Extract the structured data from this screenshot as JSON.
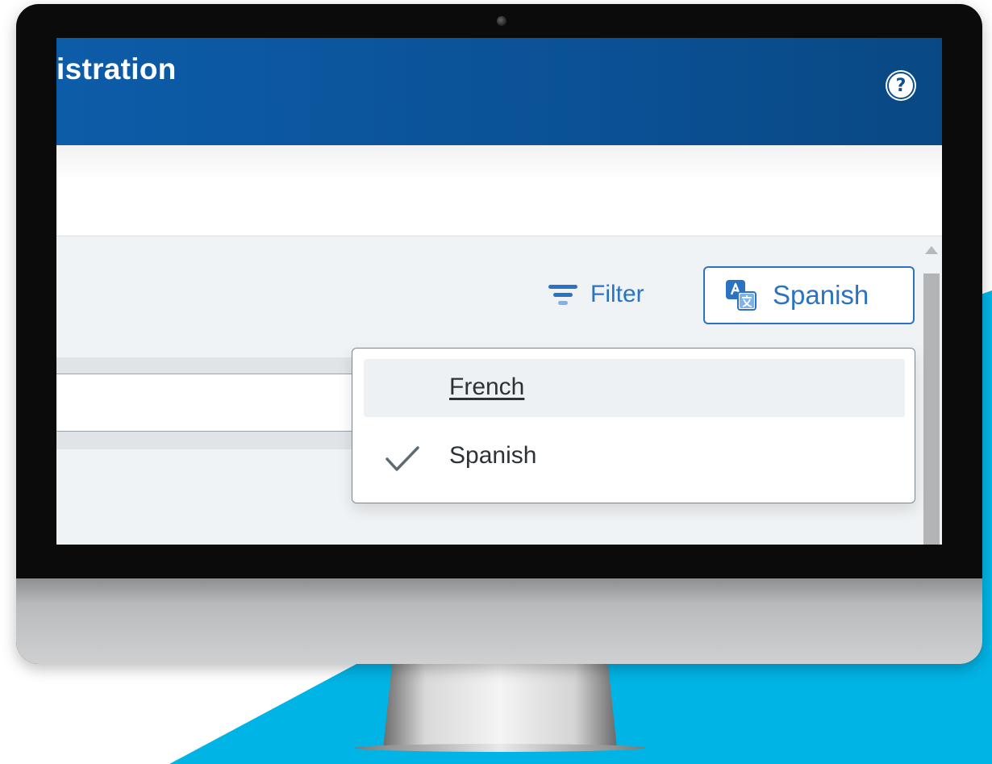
{
  "header": {
    "title": "istration",
    "help_glyph": "?"
  },
  "toolbar": {
    "filter_label": "Filter",
    "language_button_label": "Spanish",
    "filter_icon": "filter-icon",
    "language_icon": "translate-icon"
  },
  "language_menu": {
    "options": [
      {
        "label": "French",
        "selected": false,
        "hovered": true
      },
      {
        "label": "Spanish",
        "selected": true,
        "hovered": false
      }
    ]
  },
  "colors": {
    "header_blue": "#0b55a0",
    "accent_link": "#2b73c2",
    "background_accent": "#00b4e6"
  }
}
